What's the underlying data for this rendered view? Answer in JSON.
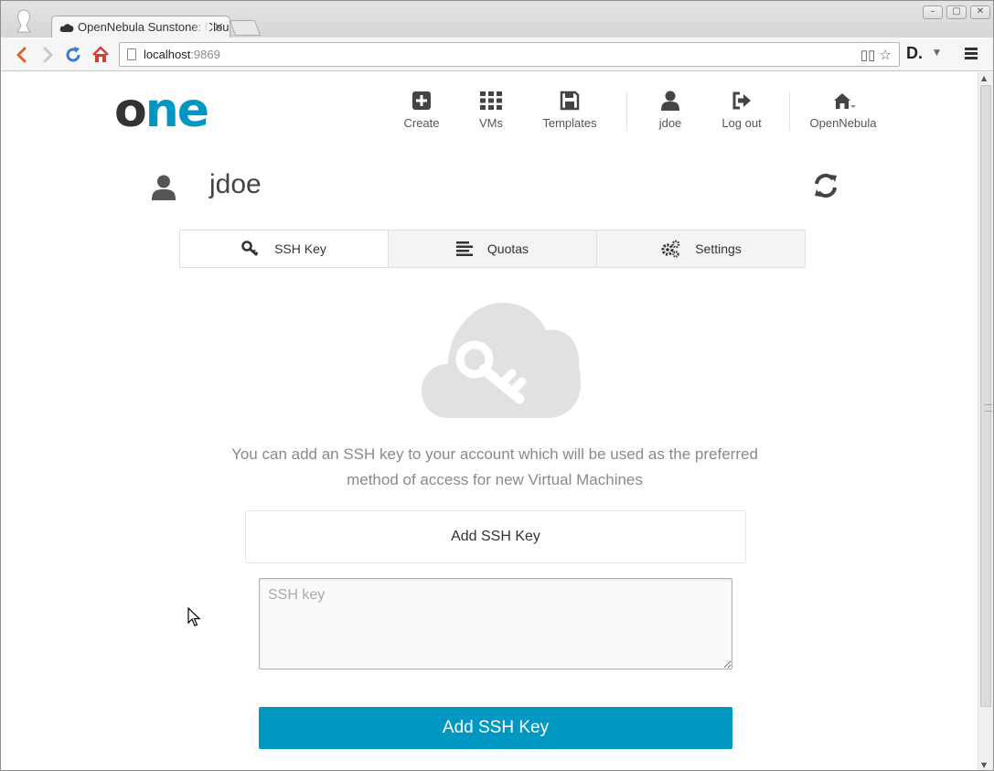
{
  "browser": {
    "tab_title": "OpenNebula Sunstone: Cloud View",
    "url_host": "localhost",
    "url_port": ":9869",
    "extension_label": "D."
  },
  "header": {
    "logo_o": "o",
    "logo_ne": "ne",
    "nav": [
      {
        "label": "Create",
        "icon": "plus-square-icon"
      },
      {
        "label": "VMs",
        "icon": "grid-icon"
      },
      {
        "label": "Templates",
        "icon": "save-icon"
      },
      {
        "label": "jdoe",
        "icon": "user-icon"
      },
      {
        "label": "Log out",
        "icon": "sign-out-icon"
      },
      {
        "label": "OpenNebula",
        "icon": "home-icon"
      }
    ]
  },
  "user": {
    "name": "jdoe"
  },
  "tabs": [
    {
      "label": "SSH Key",
      "icon": "key-icon",
      "active": true
    },
    {
      "label": "Quotas",
      "icon": "align-left-icon",
      "active": false
    },
    {
      "label": "Settings",
      "icon": "gears-icon",
      "active": false
    }
  ],
  "ssh": {
    "description": "You can add an SSH key to your account which will be used as the preferred method of access for new Virtual Machines",
    "section_title": "Add SSH Key",
    "input_value": "",
    "input_placeholder": "SSH key",
    "submit_label": "Add SSH Key"
  },
  "colors": {
    "accent": "#0098c3",
    "logo_dark": "#333333",
    "muted_text": "#8a8a8a"
  }
}
